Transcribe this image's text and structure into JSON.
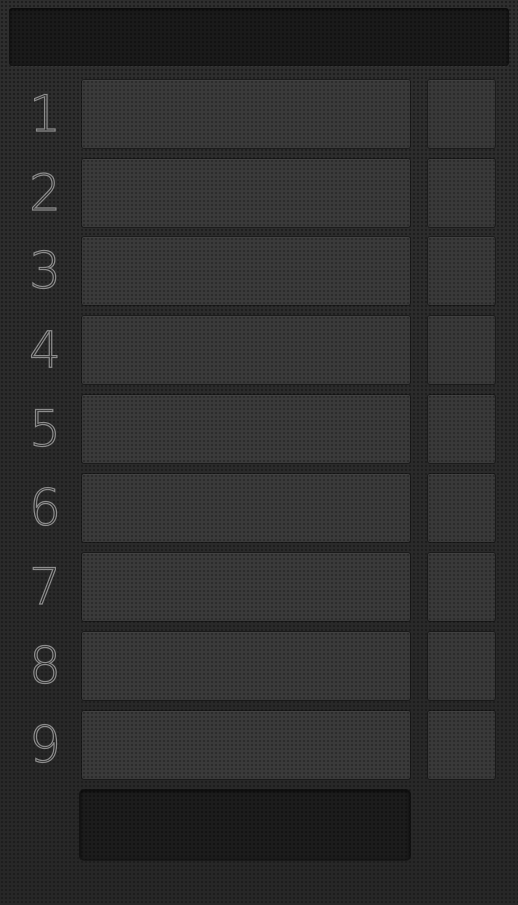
{
  "header": {
    "title": ""
  },
  "rows": [
    {
      "number": "1"
    },
    {
      "number": "2"
    },
    {
      "number": "3"
    },
    {
      "number": "4"
    },
    {
      "number": "5"
    },
    {
      "number": "6"
    },
    {
      "number": "7"
    },
    {
      "number": "8"
    },
    {
      "number": "9"
    }
  ],
  "footer": {
    "button_label": ""
  },
  "colors": {
    "background": "#2b2b2b",
    "field": "#3a3a3a",
    "dark_panel": "#1a1a1a",
    "number_outline": "#8c8c8c"
  }
}
